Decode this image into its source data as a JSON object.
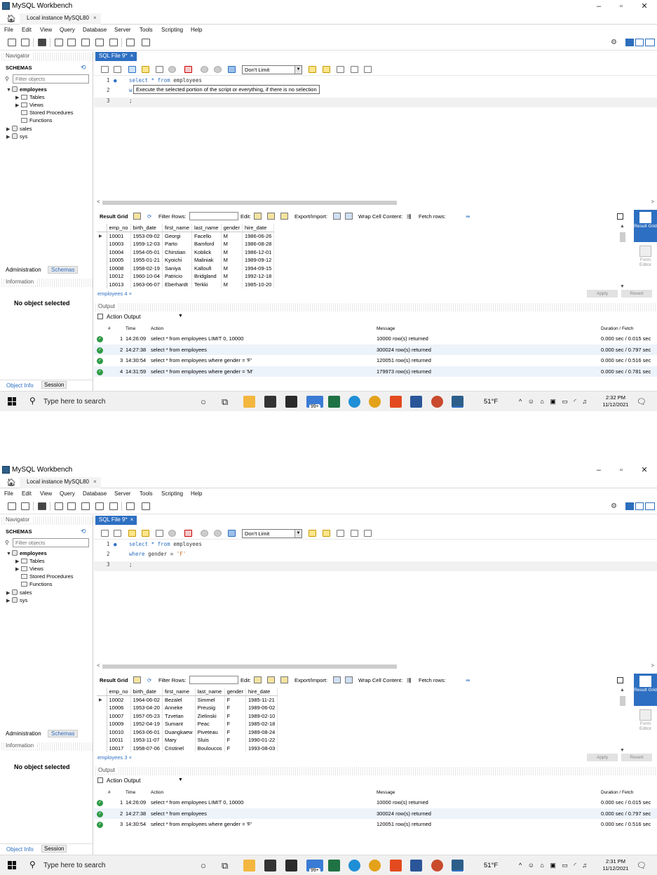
{
  "app": {
    "title": "MySQL Workbench",
    "connection_tab": "Local instance MySQL80",
    "tab_close": "×",
    "win_min": "–",
    "win_max": "▫",
    "win_close": "✕"
  },
  "menu": [
    "File",
    "Edit",
    "View",
    "Query",
    "Database",
    "Server",
    "Tools",
    "Scripting",
    "Help"
  ],
  "sidebar": {
    "navigator": "Navigator",
    "schemas": "SCHEMAS",
    "filter_placeholder": "Filter objects",
    "tree": [
      "employees",
      "Tables",
      "Views",
      "Stored Procedures",
      "Functions",
      "sales",
      "sys"
    ],
    "admin_tab": "Administration",
    "schemas_tab": "Schemas",
    "information": "Information",
    "no_object": "No object selected",
    "object_info_tab": "Object Info",
    "session_tab": "Session"
  },
  "editor": {
    "doc_tab": "SQL File 9*",
    "doc_close": "×",
    "limit": "Don't Limit",
    "bullet": "●",
    "line_numbers": [
      "1",
      "2",
      "3"
    ]
  },
  "result_toolbar": {
    "result_grid": "Result Grid",
    "filter_rows": "Filter Rows:",
    "edit": "Edit:",
    "export_import": "Export/Import:",
    "wrap": "Wrap Cell Content:",
    "fetch": "Fetch rows:"
  },
  "grid_columns": [
    "emp_no",
    "birth_date",
    "first_name",
    "last_name",
    "gender",
    "hire_date"
  ],
  "side_panel": {
    "result_grid": "Result Grid",
    "form_editor": "Form Editor",
    "apply": "Apply",
    "revert": "Revert"
  },
  "output": {
    "title": "Output",
    "selector": "Action Output",
    "headers": [
      "#",
      "Time",
      "Action",
      "Message",
      "Duration / Fetch"
    ],
    "check": "✓"
  },
  "taskbar": {
    "search": "Type here to search",
    "weather": "51°F",
    "date": "11/12/2021",
    "badge": "99+"
  },
  "shot1": {
    "sql_line1_kw": "select * from",
    "sql_line1_rest": " employees",
    "sql_line2_partial": "w",
    "sql_line3": ";",
    "tooltip": "Execute the selected portion of the script or everything, if there is no selection",
    "rows": [
      [
        "10001",
        "1953-09-02",
        "Georgi",
        "Facello",
        "M",
        "1986-06-26"
      ],
      [
        "10003",
        "1959-12-03",
        "Parto",
        "Bamford",
        "M",
        "1986-08-28"
      ],
      [
        "10004",
        "1954-05-01",
        "Chirstian",
        "Koblick",
        "M",
        "1986-12-01"
      ],
      [
        "10005",
        "1955-01-21",
        "Kyoichi",
        "Maliniak",
        "M",
        "1989-09-12"
      ],
      [
        "10008",
        "1958-02-19",
        "Saniya",
        "Kalloufi",
        "M",
        "1994-09-15"
      ],
      [
        "10012",
        "1960-10-04",
        "Patricio",
        "Bridgland",
        "M",
        "1992-12-18"
      ],
      [
        "10013",
        "1963-06-07",
        "Eberhardt",
        "Terkki",
        "M",
        "1985-10-20"
      ]
    ],
    "result_tab": "employees 4",
    "log": [
      [
        "1",
        "14:26:09",
        "select * from employees LIMIT 0, 10000",
        "10000 row(s) returned",
        "0.000 sec / 0.015 sec"
      ],
      [
        "2",
        "14:27:38",
        "select * from employees",
        "300024 row(s) returned",
        "0.000 sec / 0.797 sec"
      ],
      [
        "3",
        "14:30:54",
        "select * from employees where gender = 'F'",
        "120051 row(s) returned",
        "0.000 sec / 0.516 sec"
      ],
      [
        "4",
        "14:31:59",
        "select * from employees where gender = 'M'",
        "179973 row(s) returned",
        "0.000 sec / 0.781 sec"
      ]
    ],
    "time": "2:32 PM"
  },
  "shot2": {
    "sql_line1_kw": "select * from",
    "sql_line1_rest": " employees",
    "sql_line2_kw": "where",
    "sql_line2_mid": " gender = ",
    "sql_line2_str": "'F'",
    "sql_line3": ";",
    "rows": [
      [
        "10002",
        "1964-06-02",
        "Bezalel",
        "Simmel",
        "F",
        "1985-11-21"
      ],
      [
        "10006",
        "1953-04-20",
        "Anneke",
        "Preusig",
        "F",
        "1989-06-02"
      ],
      [
        "10007",
        "1957-05-23",
        "Tzvetan",
        "Zielinski",
        "F",
        "1989-02-10"
      ],
      [
        "10009",
        "1952-04-19",
        "Sumant",
        "Peac",
        "F",
        "1985-02-18"
      ],
      [
        "10010",
        "1963-06-01",
        "Duangkaew",
        "Piveteau",
        "F",
        "1989-08-24"
      ],
      [
        "10011",
        "1953-11-07",
        "Mary",
        "Sluis",
        "F",
        "1990-01-22"
      ],
      [
        "10017",
        "1958-07-06",
        "Cristinel",
        "Bouloucos",
        "F",
        "1993-08-03"
      ]
    ],
    "result_tab": "employees 3",
    "log": [
      [
        "1",
        "14:26:09",
        "select * from employees LIMIT 0, 10000",
        "10000 row(s) returned",
        "0.000 sec / 0.015 sec"
      ],
      [
        "2",
        "14:27:38",
        "select * from employees",
        "300024 row(s) returned",
        "0.000 sec / 0.797 sec"
      ],
      [
        "3",
        "14:30:54",
        "select * from employees where gender = 'F'",
        "120051 row(s) returned",
        "0.000 sec / 0.516 sec"
      ]
    ],
    "time": "2:31 PM"
  }
}
